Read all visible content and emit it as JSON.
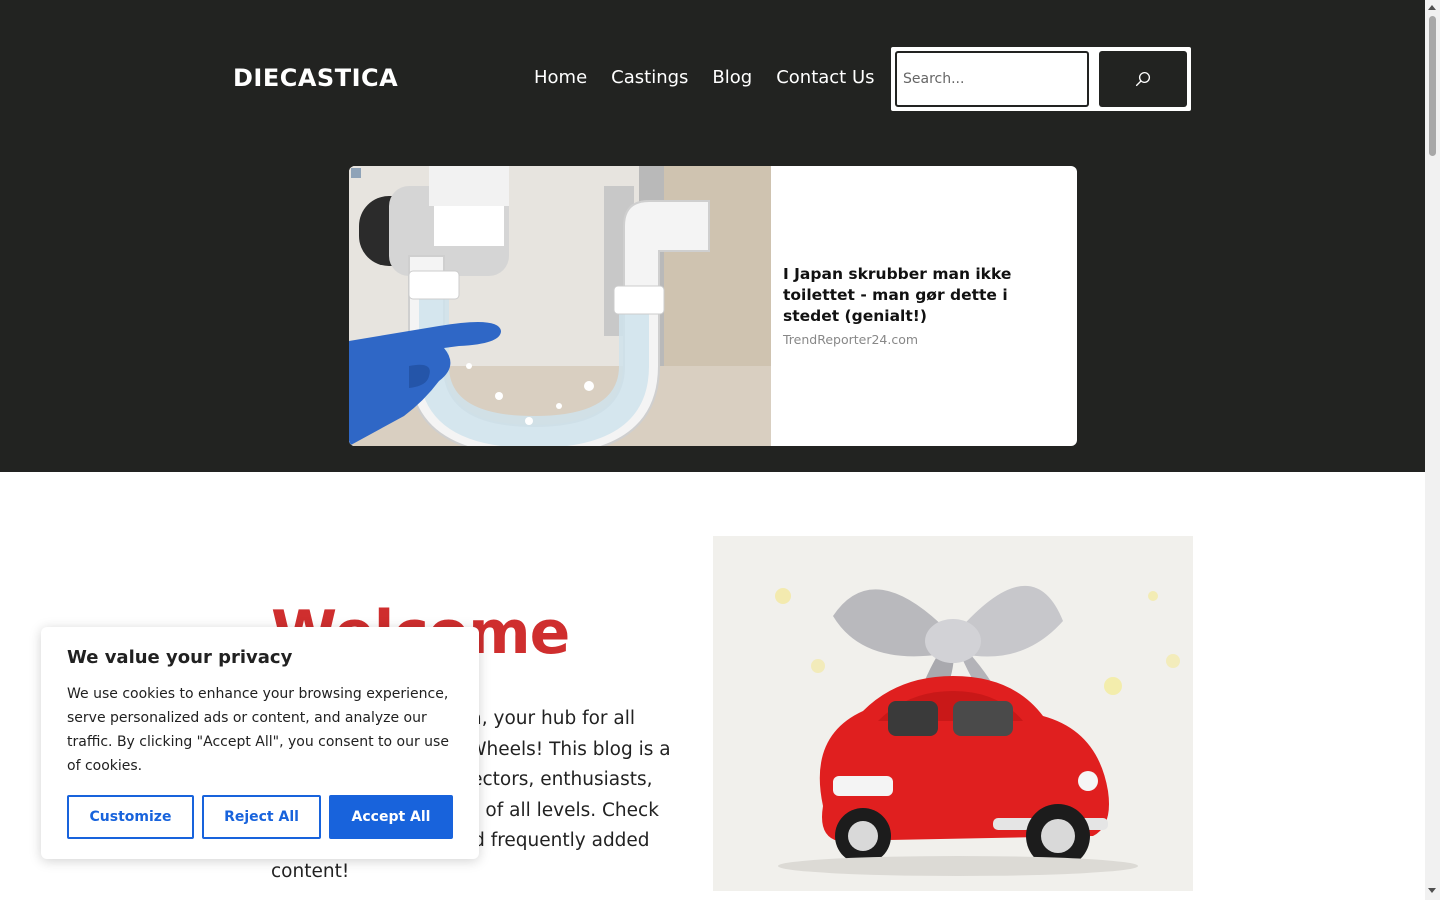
{
  "site": {
    "title": "DIECASTICA"
  },
  "nav": {
    "items": [
      "Home",
      "Castings",
      "Blog",
      "Contact Us"
    ]
  },
  "search": {
    "placeholder": "Search...",
    "button_icon": "search-icon"
  },
  "ad": {
    "title": "I Japan skrubber man ikke toilettet - man gør dette i stedet (genialt!)",
    "source": "TrendReporter24.com",
    "image_icon": "sink-pipe-photo"
  },
  "hero": {
    "heading": "Welcome",
    "intro": "Welcome to Diecastica, your hub for all things related to Hot Wheels! This blog is a treasure trove for collectors, enthusiasts, and Hot Wheels lovers of all levels. Check back often for new and frequently added content!",
    "image_icon": "red-toy-car-with-bow-photo"
  },
  "cookie": {
    "title": "We value your privacy",
    "text": "We use cookies to enhance your browsing experience, serve personalized ads or content, and analyze our traffic. By clicking \"Accept All\", you consent to our use of cookies.",
    "customize": "Customize",
    "reject": "Reject All",
    "accept": "Accept All"
  },
  "colors": {
    "header_bg": "#222321",
    "accent_red": "#cf2e2e",
    "cookie_blue": "#1863dc"
  }
}
